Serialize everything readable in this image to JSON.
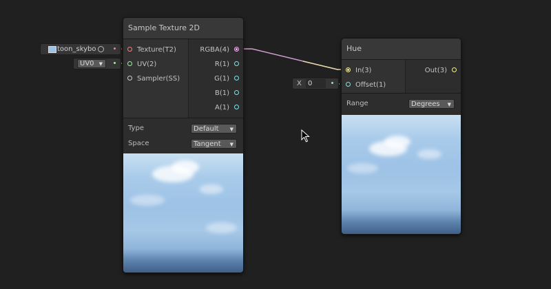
{
  "nodes": {
    "sample_texture": {
      "title": "Sample Texture 2D",
      "inputs": [
        {
          "label": "Texture(T2)",
          "color": "#ff8080"
        },
        {
          "label": "UV(2)",
          "color": "#9ff29f"
        },
        {
          "label": "Sampler(SS)",
          "color": "#cfcfcf"
        }
      ],
      "outputs": [
        {
          "label": "RGBA(4)",
          "color": "#f5b5f0"
        },
        {
          "label": "R(1)",
          "color": "#84e4e7"
        },
        {
          "label": "G(1)",
          "color": "#84e4e7"
        },
        {
          "label": "B(1)",
          "color": "#84e4e7"
        },
        {
          "label": "A(1)",
          "color": "#84e4e7"
        }
      ],
      "properties": [
        {
          "label": "Type",
          "value": "Default"
        },
        {
          "label": "Space",
          "value": "Tangent"
        }
      ]
    },
    "hue": {
      "title": "Hue",
      "inputs": [
        {
          "label": "In(3)",
          "color": "#f5f29a"
        },
        {
          "label": "Offset(1)",
          "color": "#84e4e7"
        }
      ],
      "outputs": [
        {
          "label": "Out(3)",
          "color": "#f5f29a"
        }
      ],
      "properties": [
        {
          "label": "Range",
          "value": "Degrees"
        }
      ]
    }
  },
  "inline_inputs": {
    "texture_asset": "toon_skybo",
    "uv_channel": "UV0",
    "offset_axis": "X",
    "offset_value": "0"
  },
  "colors": {
    "wire_rgba": "#f5b5f0",
    "wire_in": "#f5f29a",
    "background": "#202020"
  }
}
